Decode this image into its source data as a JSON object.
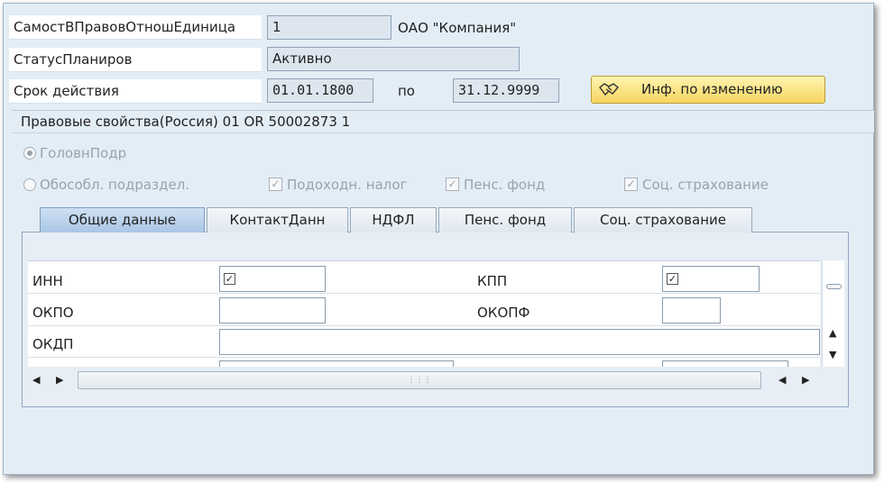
{
  "header": {
    "unit_label": "СамостВПравовОтношЕдиница",
    "unit_value": "1",
    "company_name": "ОАО \"Компания\"",
    "status_label": "СтатусПланиров",
    "status_value": "Активно",
    "validity_label": "Срок действия",
    "date_from": "01.01.1800",
    "to_label": "по",
    "date_to": "31.12.9999",
    "change_info_button": "Инф. по изменению"
  },
  "group": {
    "title": "Правовые свойства(Россия) 01 OR 50002873 1",
    "radio_head": "ГоловнПодр",
    "radio_branch": "Обособл. подраздел.",
    "check_income_tax": "Подоходн. налог",
    "check_pension": "Пенс. фонд",
    "check_social": "Соц. страхование"
  },
  "tabs": [
    {
      "label": "Общие данные",
      "active": true
    },
    {
      "label": "КонтактДанн",
      "active": false
    },
    {
      "label": "НДФЛ",
      "active": false
    },
    {
      "label": "Пенс. фонд",
      "active": false
    },
    {
      "label": "Соц. страхование",
      "active": false
    }
  ],
  "fields": {
    "inn_label": "ИНН",
    "kpp_label": "КПП",
    "okpo_label": "ОКПО",
    "okopf_label": "ОКОПФ",
    "okdp_label": "ОКДП"
  },
  "icons": {
    "change_info": "handshake-icon",
    "scroll_left": "arrow-left-icon",
    "scroll_right": "arrow-right-icon",
    "scroll_up": "arrow-up-icon",
    "scroll_down": "arrow-down-icon",
    "checkbox_mark": "✓"
  },
  "colors": {
    "background": "#e3edf6",
    "button": "#f6d560",
    "active_tab": "#a9c6e6"
  }
}
